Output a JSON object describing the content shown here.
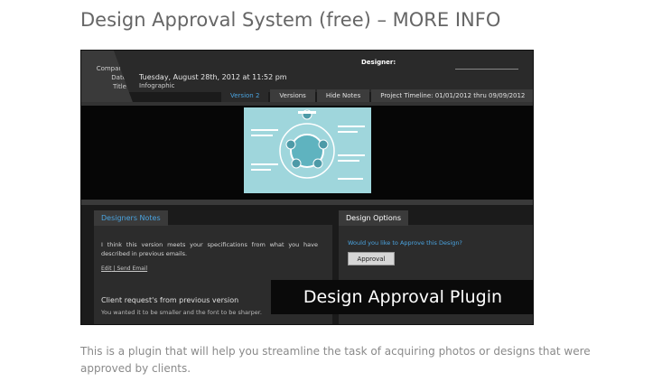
{
  "post": {
    "title": "Design Approval System (free) – MORE INFO",
    "description": "This is a plugin that will help you streamline the task of acquiring photos or designs that were approved by clients."
  },
  "screenshot": {
    "labels": {
      "company": "Company",
      "date": "Date",
      "title": "Title"
    },
    "date_value": "Tuesday, August 28th, 2012 at 11:52 pm",
    "title_value": "Infographic",
    "designer_label": "Designer:",
    "tabs": [
      "Version 2",
      "Versions",
      "Hide Notes",
      "Project Timeline: 01/01/2012 thru 09/09/2012"
    ],
    "notes": {
      "tab": "Designers Notes",
      "text": "I think this version meets your specifications from what you have described in previous emails.",
      "edit_link": "Edit",
      "send_link": "Send Email",
      "request_title": "Client request's from previous version",
      "request_text": "You wanted it to be smaller and the font to be sharper."
    },
    "options": {
      "tab": "Design Options",
      "question": "Would you like to Approve this Design?",
      "button": "Approval"
    },
    "overlay_text": "Design Approval Plugin"
  },
  "colors": {
    "accent": "#4aa3df",
    "infographic": "#9fd6dc"
  }
}
